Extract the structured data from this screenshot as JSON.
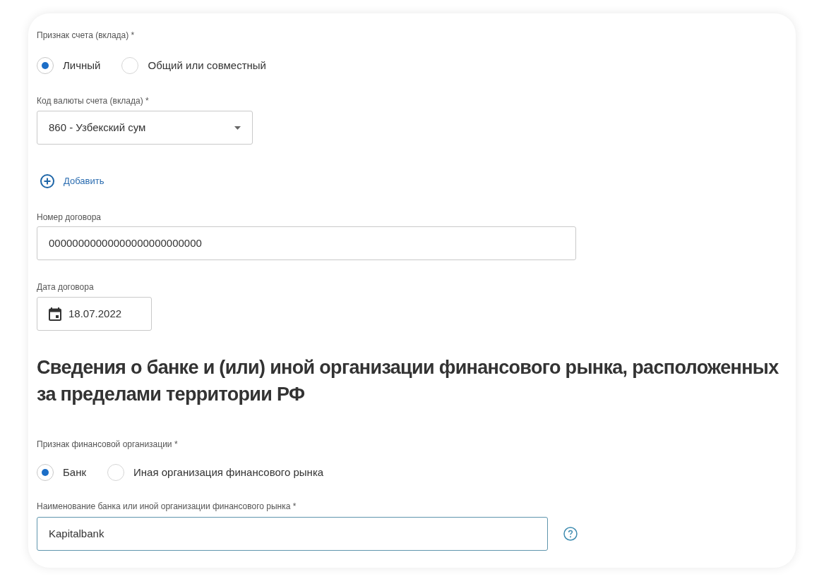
{
  "account_type": {
    "label": "Признак счета (вклада) *",
    "options": [
      {
        "label": "Личный",
        "selected": true
      },
      {
        "label": "Общий или совместный",
        "selected": false
      }
    ]
  },
  "currency": {
    "label": "Код валюты счета (вклада) *",
    "value": "860 - Узбекский сум"
  },
  "add_button": {
    "label": "Добавить"
  },
  "contract_number": {
    "label": "Номер договора",
    "value": "00000000000000000000000000"
  },
  "contract_date": {
    "label": "Дата договора",
    "value": "18.07.2022"
  },
  "bank_section": {
    "title": "Сведения о банке и (или) иной организации финансового рынка, расположенных за пределами территории РФ",
    "org_type": {
      "label": "Признак финансовой организации *",
      "options": [
        {
          "label": "Банк",
          "selected": true
        },
        {
          "label": "Иная организация финансового рынка",
          "selected": false
        }
      ]
    },
    "org_name": {
      "label": "Наименование банка или иной организации финансового рынка *",
      "value": "Kapitalbank",
      "focused": true
    }
  }
}
